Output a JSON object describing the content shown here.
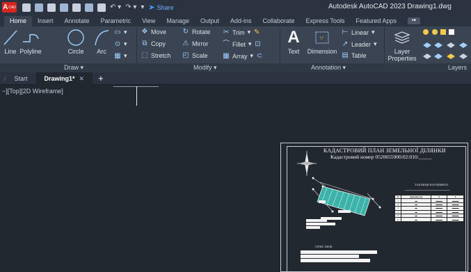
{
  "titlebar": {
    "app_logo": "A",
    "app_logo_sub": "CAD",
    "share_label": "Share",
    "title": "Autodesk AutoCAD 2023   Drawing1.dwg"
  },
  "ribbon_tabs": [
    "Home",
    "Insert",
    "Annotate",
    "Parametric",
    "View",
    "Manage",
    "Output",
    "Add-ins",
    "Collaborate",
    "Express Tools",
    "Featured Apps"
  ],
  "draw_panel": {
    "label": "Draw ▾",
    "tools": [
      "Line",
      "Polyline",
      "Circle",
      "Arc"
    ]
  },
  "modify_panel": {
    "label": "Modify ▾",
    "tools": {
      "move": "Move",
      "rotate": "Rotate",
      "trim": "Trim",
      "copy": "Copy",
      "mirror": "Mirror",
      "fillet": "Fillet",
      "stretch": "Stretch",
      "scale": "Scale",
      "array": "Array"
    }
  },
  "annotation_panel": {
    "label": "Annotation ▾",
    "text": "Text",
    "dimension": "Dimension",
    "linear": "Linear",
    "leader": "Leader",
    "table": "Table"
  },
  "layers_panel": {
    "label": "Layers",
    "layer_properties_1": "Layer",
    "layer_properties_2": "Properties"
  },
  "file_tabs": {
    "start": "Start",
    "drawing": "Drawing1*",
    "close": "✕",
    "add": "+"
  },
  "viewport": {
    "label": "−][Top][2D Wireframe]"
  },
  "drawing_sheet": {
    "title": "КАДАСТРОВИЙ ПЛАН ЗЕМЕЛЬНОЇ ДІЛЯНКИ",
    "subtitle": "Кадастровий номер 0520655900:02:010:_____",
    "table_title": "ТАБЛИЦЯ КООРДИНАТ",
    "table_header": [
      "№",
      "Довжина (м)",
      "X",
      "Y"
    ],
    "table_rows": [
      [
        "1",
        "",
        "",
        ""
      ],
      [
        "2",
        "",
        "",
        ""
      ],
      [
        "3",
        "",
        "",
        ""
      ],
      [
        "4",
        "",
        "",
        ""
      ],
      [
        "5",
        "",
        "",
        ""
      ],
      [
        "6",
        "",
        "",
        ""
      ]
    ],
    "legend_label": "ОПИС МЕЖ"
  },
  "colors": {
    "accent": "#3fa0ff",
    "parcel_fill": "#3bb3a8",
    "background": "#212830",
    "ribbon": "#3a4452"
  }
}
